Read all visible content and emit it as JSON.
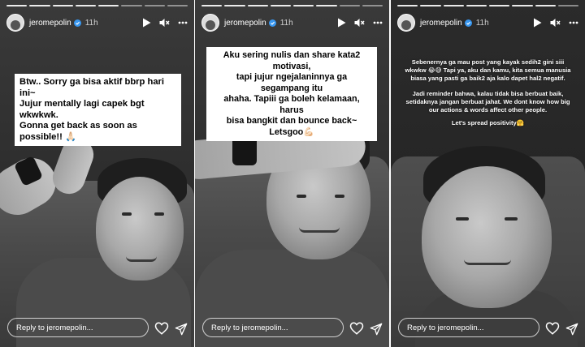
{
  "stories": [
    {
      "username": "jeromepolin",
      "time": "11h",
      "text": "Btw.. Sorry ga bisa aktif bbrp hari ini~\nJujur mentally lagi capek bgt wkwkwk.\nGonna get back as soon as possible!! 🙏🏻",
      "reply_placeholder": "Reply to jeromepolin..."
    },
    {
      "username": "jeromepolin",
      "time": "11h",
      "text": "Aku sering nulis dan share kata2 motivasi,\ntapi jujur ngejalaninnya ga segampang itu\nahaha. Tapiii ga boleh kelamaan, harus\nbisa bangkit dan bounce back~ Letsgoo💪🏻",
      "reply_placeholder": "Reply to jeromepolin..."
    },
    {
      "username": "jeromepolin",
      "time": "11h",
      "paragraphs": [
        "Sebenernya ga mau post yang kayak sedih2 gini siii\nwkwkw 😂😅 Tapi ya, aku dan kamu, kita semua manusia\nbiasa yang pasti ga baik2 aja kalo dapet hal2 negatif.",
        "Jadi reminder bahwa, kalau tidak bisa berbuat baik,\nsetidaknya jangan berbuat jahat. We dont know how big\nour actions & words affect other people.",
        "Let's spread positivity🤗"
      ],
      "reply_placeholder": "Reply to jeromepolin..."
    }
  ],
  "icons": {
    "play": "play-icon",
    "mute": "mute-icon",
    "more": "more-icon",
    "heart": "heart-icon",
    "send": "send-icon",
    "verified": "verified-badge-icon"
  },
  "colors": {
    "verified": "#3897f0",
    "sticker_bg": "#ffffff"
  }
}
